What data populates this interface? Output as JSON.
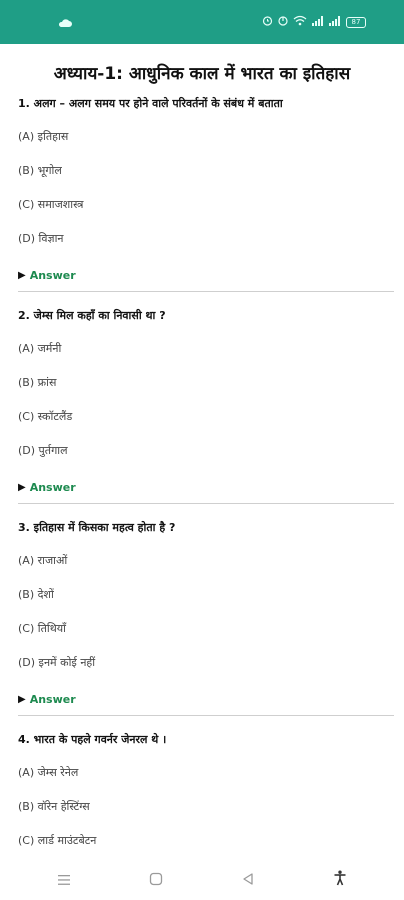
{
  "status_bar": {
    "color": "#1f9e86",
    "left_icon": "cloud-icon",
    "right_icons": [
      "alarm-icon",
      "dnd-icon",
      "wifi-icon",
      "signal-icon",
      "signal-icon",
      "battery-icon"
    ],
    "battery_text": "87"
  },
  "page": {
    "title": "अध्याय-1: आधुनिक काल में भारत का इतिहास"
  },
  "questions": [
    {
      "question": "1. अलग – अलग समय पर होने वाले परिवर्तनों के संबंध में बताता",
      "options": [
        "(A) इतिहास",
        "(B) भूगोल",
        "(C) समाजशास्त्र",
        "(D) विज्ञान"
      ],
      "answer_label": "Answer"
    },
    {
      "question": "2. जेम्स मिल कहाँ का निवासी था ?",
      "options": [
        "(A) जर्मनी",
        "(B) फ्रांस",
        "(C) स्कॉटलैंड",
        "(D) पुर्तगाल"
      ],
      "answer_label": "Answer"
    },
    {
      "question": "3. इतिहास में किसका महत्व होता है ?",
      "options": [
        "(A) राजाओं",
        "(B) देशों",
        "(C) तिथियाँ",
        "(D) इनमें कोई नहीं"
      ],
      "answer_label": "Answer"
    },
    {
      "question": "4. भारत के पहले गवर्नर जेनरल थे ।",
      "options": [
        "(A) जेम्स रेनेल",
        "(B) वॉरेन हेस्टिंग्स",
        "(C) लार्ड माउंटबेटन"
      ],
      "answer_label": ""
    }
  ],
  "nav_bar": {
    "items": [
      "menu-icon",
      "home-icon",
      "back-icon",
      "accessibility-icon"
    ]
  },
  "colors": {
    "accent": "#1f9e86",
    "answer": "#1d8a4f"
  }
}
